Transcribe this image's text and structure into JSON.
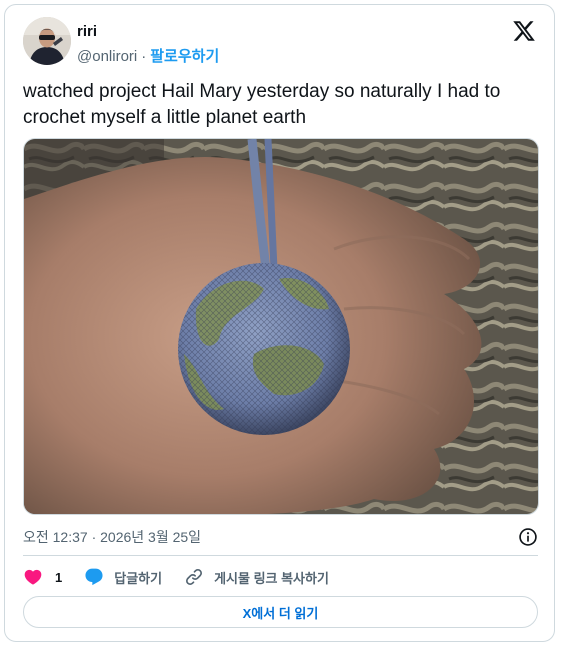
{
  "header": {
    "display_name": "riri",
    "handle": "@onlirori",
    "separator": "·",
    "follow_label": "팔로우하기"
  },
  "tweet": {
    "text": "watched project Hail Mary yesterday so naturally I had to crochet myself a little planet earth",
    "image_alt": "crocheted planet earth keychain held in a palm"
  },
  "meta": {
    "timestamp": "오전 12:37 · 2026년 3월 25일"
  },
  "actions": {
    "like_count": "1",
    "reply_label": "답글하기",
    "copy_link_label": "게시물 링크 복사하기"
  },
  "read_more_label": "X에서 더 읽기",
  "colors": {
    "accent": "#1d9bf0",
    "like": "#f91880",
    "muted_text": "#536471",
    "border": "#cfd9de",
    "link_button_text": "#006fd6"
  },
  "icons": {
    "brand": "x-logo-icon",
    "info": "info-icon",
    "like": "heart-icon",
    "reply": "speech-bubble-icon",
    "copy_link": "link-icon"
  }
}
